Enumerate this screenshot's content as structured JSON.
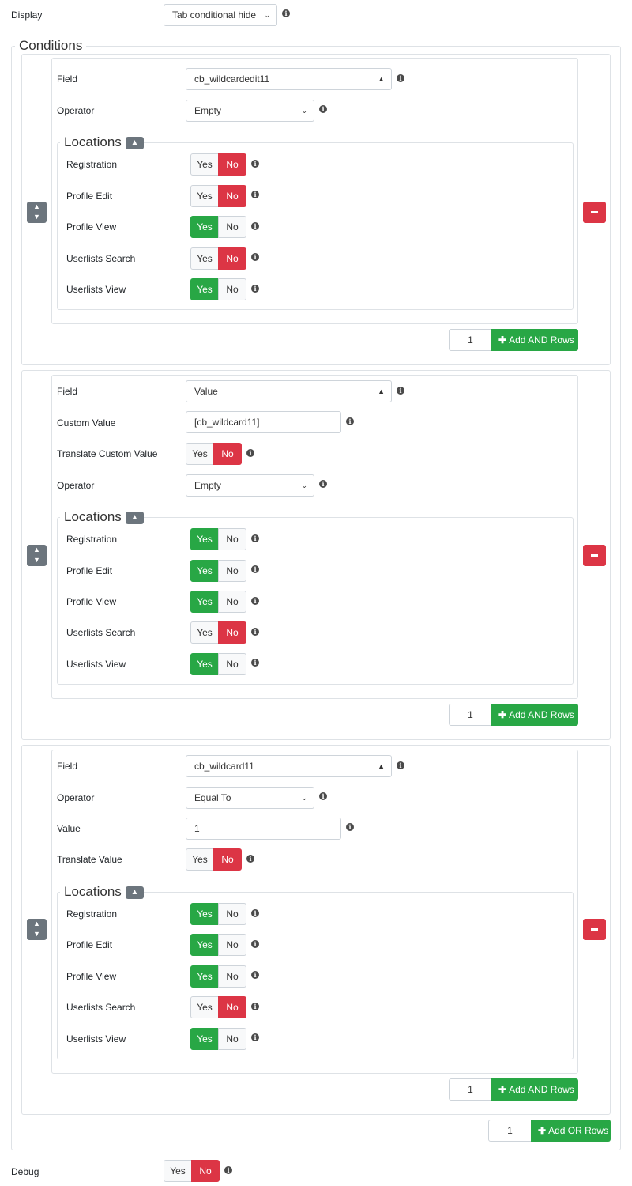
{
  "display": {
    "label": "Display",
    "value": "Tab conditional hide"
  },
  "conditions_title": "Conditions",
  "locations_title": "Locations",
  "yes": "Yes",
  "no": "No",
  "row_count": "1",
  "add_and_rows": "Add AND Rows",
  "add_or_rows": "Add OR Rows",
  "labels": {
    "field": "Field",
    "operator": "Operator",
    "custom_value": "Custom Value",
    "translate_custom_value": "Translate Custom Value",
    "value": "Value",
    "translate_value": "Translate Value",
    "registration": "Registration",
    "profile_edit": "Profile Edit",
    "profile_view": "Profile View",
    "userlists_search": "Userlists Search",
    "userlists_view": "Userlists View"
  },
  "condition1": {
    "field": "cb_wildcardedit11",
    "operator": "Empty",
    "locations": {
      "registration": "No",
      "profile_edit": "No",
      "profile_view": "Yes",
      "userlists_search": "No",
      "userlists_view": "Yes"
    }
  },
  "condition2": {
    "field": "Value",
    "custom_value": "[cb_wildcard11]",
    "translate_custom_value": "No",
    "operator": "Empty",
    "locations": {
      "registration": "Yes",
      "profile_edit": "Yes",
      "profile_view": "Yes",
      "userlists_search": "No",
      "userlists_view": "Yes"
    }
  },
  "condition3": {
    "field": "cb_wildcard11",
    "operator": "Equal To",
    "value": "1",
    "translate_value": "No",
    "locations": {
      "registration": "Yes",
      "profile_edit": "Yes",
      "profile_view": "Yes",
      "userlists_search": "No",
      "userlists_view": "Yes"
    }
  },
  "debug": {
    "label": "Debug",
    "value": "No"
  }
}
